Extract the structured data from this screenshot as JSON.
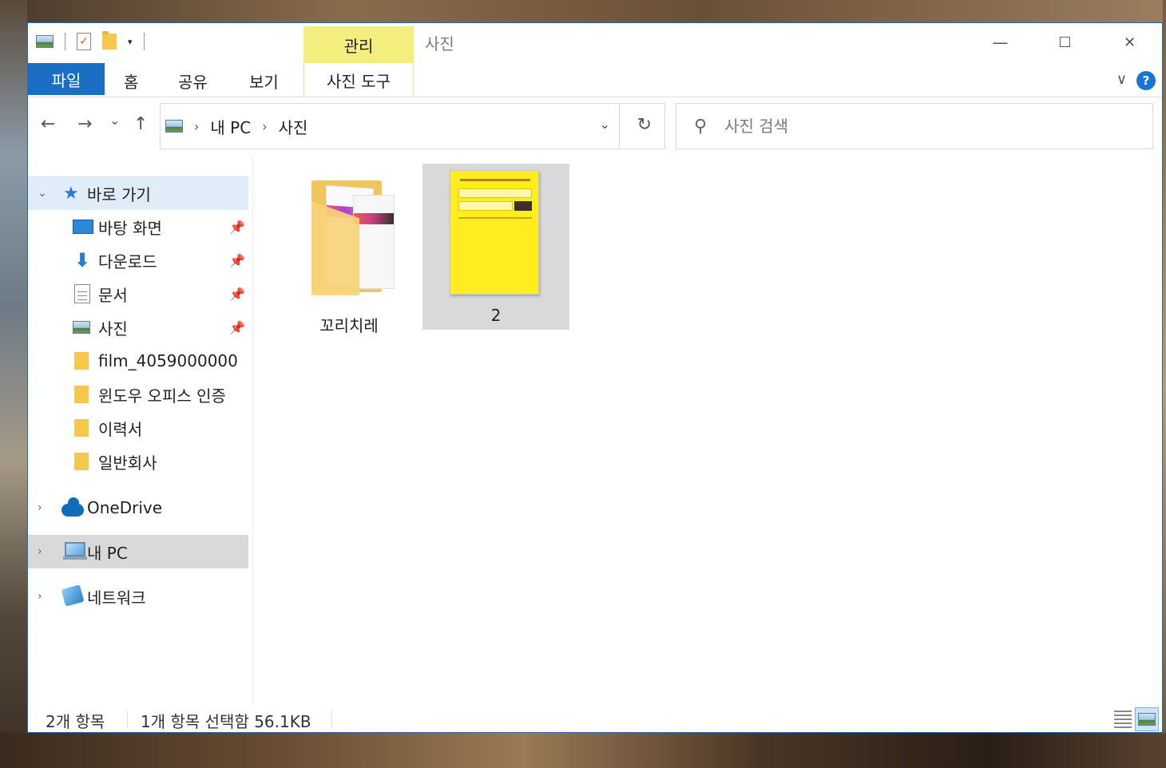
{
  "window": {
    "title": "사진",
    "contextual_tab_group": "관리",
    "controls": {
      "minimize": "—",
      "maximize": "☐",
      "close": "✕"
    }
  },
  "quick_access_toolbar": {
    "dropdown": "▾"
  },
  "ribbon": {
    "tabs": [
      "파일",
      "홈",
      "공유",
      "보기",
      "사진 도구"
    ],
    "collapse_chevron": "∨",
    "help": "?"
  },
  "navigation": {
    "back": "←",
    "forward": "→",
    "recent": "⌄",
    "up": "↑",
    "breadcrumb": [
      "내 PC",
      "사진"
    ],
    "breadcrumb_sep": "›",
    "dropdown": "⌄",
    "refresh": "↻"
  },
  "search": {
    "placeholder": "사진 검색",
    "value": ""
  },
  "sidebar": {
    "quick_access": {
      "label": "바로 가기",
      "items": [
        {
          "label": "바탕 화면",
          "icon": "desktop-icon",
          "pinned": true
        },
        {
          "label": "다운로드",
          "icon": "download-icon",
          "pinned": true
        },
        {
          "label": "문서",
          "icon": "document-icon",
          "pinned": true
        },
        {
          "label": "사진",
          "icon": "pictures-icon",
          "pinned": true
        },
        {
          "label": "film_4059000000",
          "icon": "folder-icon",
          "pinned": false
        },
        {
          "label": "윈도우 오피스 인증",
          "icon": "folder-icon",
          "pinned": false
        },
        {
          "label": "이력서",
          "icon": "folder-icon",
          "pinned": false
        },
        {
          "label": "일반회사",
          "icon": "folder-icon",
          "pinned": false
        }
      ]
    },
    "onedrive": {
      "label": "OneDrive"
    },
    "this_pc": {
      "label": "내 PC"
    },
    "network": {
      "label": "네트워크"
    }
  },
  "content": {
    "items": [
      {
        "name": "꼬리치레",
        "type": "folder",
        "selected": false
      },
      {
        "name": "2",
        "type": "image",
        "selected": true
      }
    ]
  },
  "status": {
    "count": "2개 항목",
    "selection": "1개 항목 선택함 56.1KB"
  },
  "colors": {
    "accent": "#1a6fc4",
    "contextual_tab": "#f4ee7e",
    "selection": "#d9d9d9",
    "thumbnail": "#ffed1f"
  }
}
